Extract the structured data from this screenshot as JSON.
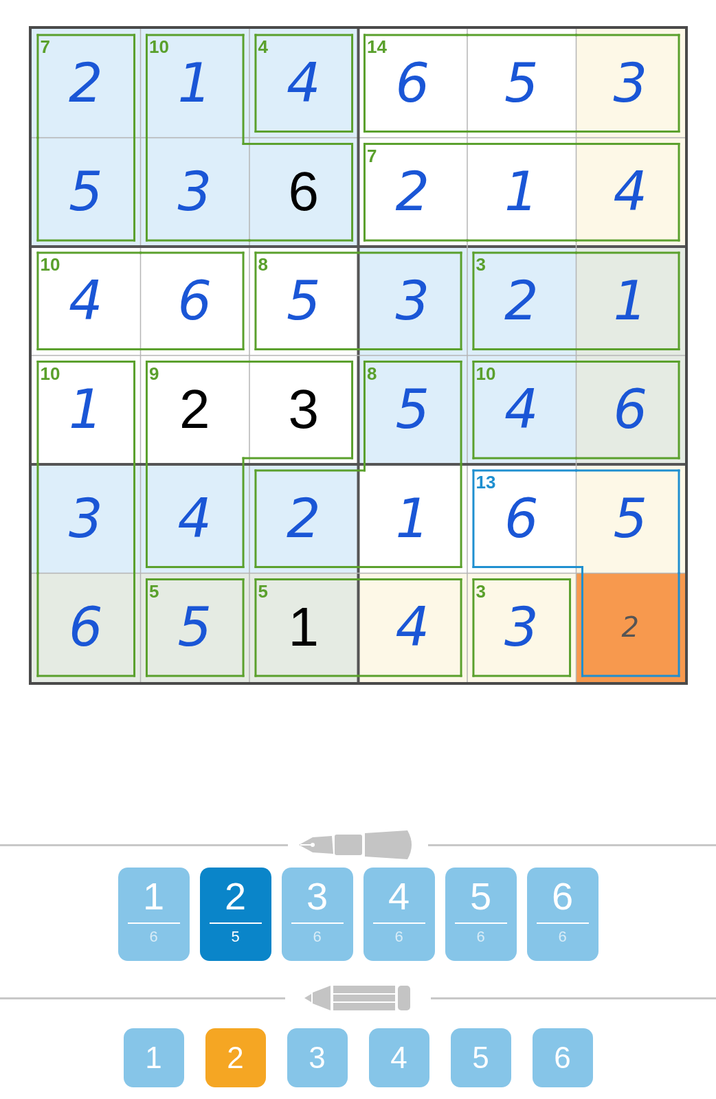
{
  "grid": {
    "rows": [
      [
        {
          "value": "2",
          "kind": "entered",
          "color": "#ddeefa",
          "selected": false,
          "cage": {
            "sum": "7",
            "color": "#5aa02c",
            "top": true,
            "right": true,
            "bottom": false,
            "left": true
          }
        },
        {
          "value": "1",
          "kind": "entered",
          "color": "#ddeefa",
          "selected": false,
          "cage": {
            "sum": "10",
            "color": "#5aa02c",
            "top": true,
            "right": true,
            "bottom": false,
            "left": true
          }
        },
        {
          "value": "4",
          "kind": "entered",
          "color": "#ddeefa",
          "selected": false,
          "cage": {
            "sum": "4",
            "color": "#5aa02c",
            "top": true,
            "right": true,
            "bottom": true,
            "left": true
          }
        },
        {
          "value": "6",
          "kind": "entered",
          "color": "#ffffff",
          "selected": false,
          "cage": {
            "sum": "14",
            "color": "#5aa02c",
            "top": true,
            "right": false,
            "bottom": true,
            "left": true
          }
        },
        {
          "value": "5",
          "kind": "entered",
          "color": "#ffffff",
          "selected": false,
          "cage": {
            "color": "#5aa02c",
            "top": true,
            "right": false,
            "bottom": true,
            "left": false
          }
        },
        {
          "value": "3",
          "kind": "entered",
          "color": "#fdf8e7",
          "selected": false,
          "cage": {
            "color": "#5aa02c",
            "top": true,
            "right": true,
            "bottom": true,
            "left": false
          }
        }
      ],
      [
        {
          "value": "5",
          "kind": "entered",
          "color": "#ddeefa",
          "selected": false,
          "cage": {
            "color": "#5aa02c",
            "top": false,
            "right": true,
            "bottom": true,
            "left": true
          }
        },
        {
          "value": "3",
          "kind": "entered",
          "color": "#ddeefa",
          "selected": false,
          "cage": {
            "color": "#5aa02c",
            "top": false,
            "right": false,
            "bottom": true,
            "left": true
          }
        },
        {
          "value": "6",
          "kind": "given",
          "color": "#ddeefa",
          "selected": false,
          "cage": {
            "color": "#5aa02c",
            "top": true,
            "right": true,
            "bottom": true,
            "left": false
          }
        },
        {
          "value": "2",
          "kind": "entered",
          "color": "#ffffff",
          "selected": false,
          "cage": {
            "sum": "7",
            "color": "#5aa02c",
            "top": true,
            "right": false,
            "bottom": true,
            "left": true
          }
        },
        {
          "value": "1",
          "kind": "entered",
          "color": "#ffffff",
          "selected": false,
          "cage": {
            "color": "#5aa02c",
            "top": true,
            "right": false,
            "bottom": true,
            "left": false
          }
        },
        {
          "value": "4",
          "kind": "entered",
          "color": "#fdf8e7",
          "selected": false,
          "cage": {
            "color": "#5aa02c",
            "top": true,
            "right": true,
            "bottom": true,
            "left": false
          }
        }
      ],
      [
        {
          "value": "4",
          "kind": "entered",
          "color": "#ffffff",
          "selected": false,
          "cage": {
            "sum": "10",
            "color": "#5aa02c",
            "top": true,
            "right": false,
            "bottom": true,
            "left": true
          }
        },
        {
          "value": "6",
          "kind": "entered",
          "color": "#ffffff",
          "selected": false,
          "cage": {
            "color": "#5aa02c",
            "top": true,
            "right": true,
            "bottom": true,
            "left": false
          }
        },
        {
          "value": "5",
          "kind": "entered",
          "color": "#ffffff",
          "selected": false,
          "cage": {
            "sum": "8",
            "color": "#5aa02c",
            "top": true,
            "right": false,
            "bottom": true,
            "left": true
          }
        },
        {
          "value": "3",
          "kind": "entered",
          "color": "#ddeefa",
          "selected": false,
          "cage": {
            "color": "#5aa02c",
            "top": true,
            "right": true,
            "bottom": true,
            "left": false
          }
        },
        {
          "value": "2",
          "kind": "entered",
          "color": "#ddeefa",
          "selected": false,
          "cage": {
            "sum": "3",
            "color": "#5aa02c",
            "top": true,
            "right": false,
            "bottom": true,
            "left": true
          }
        },
        {
          "value": "1",
          "kind": "entered",
          "color": "#e5ebe3",
          "selected": false,
          "cage": {
            "color": "#5aa02c",
            "top": true,
            "right": true,
            "bottom": true,
            "left": false
          }
        }
      ],
      [
        {
          "value": "1",
          "kind": "entered",
          "color": "#ffffff",
          "selected": false,
          "cage": {
            "sum": "10",
            "color": "#5aa02c",
            "top": true,
            "right": true,
            "bottom": false,
            "left": true
          }
        },
        {
          "value": "2",
          "kind": "given",
          "color": "#ffffff",
          "selected": false,
          "cage": {
            "sum": "9",
            "color": "#5aa02c",
            "top": true,
            "right": false,
            "bottom": false,
            "left": true
          }
        },
        {
          "value": "3",
          "kind": "given",
          "color": "#ffffff",
          "selected": false,
          "cage": {
            "color": "#5aa02c",
            "top": true,
            "right": true,
            "bottom": true,
            "left": false
          }
        },
        {
          "value": "5",
          "kind": "entered",
          "color": "#ddeefa",
          "selected": false,
          "cage": {
            "sum": "8",
            "color": "#5aa02c",
            "top": true,
            "right": true,
            "bottom": false,
            "left": true
          }
        },
        {
          "value": "4",
          "kind": "entered",
          "color": "#ddeefa",
          "selected": false,
          "cage": {
            "sum": "10",
            "color": "#5aa02c",
            "top": true,
            "right": false,
            "bottom": true,
            "left": true
          }
        },
        {
          "value": "6",
          "kind": "entered",
          "color": "#e5ebe3",
          "selected": false,
          "cage": {
            "color": "#5aa02c",
            "top": true,
            "right": true,
            "bottom": true,
            "left": false
          }
        }
      ],
      [
        {
          "value": "3",
          "kind": "entered",
          "color": "#ddeefa",
          "selected": false,
          "cage": {
            "color": "#5aa02c",
            "top": false,
            "right": true,
            "bottom": false,
            "left": true
          }
        },
        {
          "value": "4",
          "kind": "entered",
          "color": "#ddeefa",
          "selected": false,
          "cage": {
            "color": "#5aa02c",
            "top": false,
            "right": true,
            "bottom": true,
            "left": true
          }
        },
        {
          "value": "2",
          "kind": "entered",
          "color": "#ddeefa",
          "selected": false,
          "cage": {
            "color": "#5aa02c",
            "top": true,
            "right": false,
            "bottom": true,
            "left": true
          }
        },
        {
          "value": "1",
          "kind": "entered",
          "color": "#ffffff",
          "selected": false,
          "cage": {
            "color": "#5aa02c",
            "top": false,
            "right": true,
            "bottom": true,
            "left": false
          }
        },
        {
          "value": "6",
          "kind": "entered",
          "color": "#ffffff",
          "selected": false,
          "cage": {
            "sum": "13",
            "color": "#1e8fd0",
            "top": true,
            "right": false,
            "bottom": true,
            "left": true
          }
        },
        {
          "value": "5",
          "kind": "entered",
          "color": "#fdf8e7",
          "selected": false,
          "cage": {
            "color": "#1e8fd0",
            "top": true,
            "right": true,
            "bottom": false,
            "left": false
          }
        }
      ],
      [
        {
          "value": "6",
          "kind": "entered",
          "color": "#e5ebe3",
          "selected": false,
          "cage": {
            "color": "#5aa02c",
            "top": false,
            "right": true,
            "bottom": true,
            "left": true
          }
        },
        {
          "value": "5",
          "kind": "entered",
          "color": "#e5ebe3",
          "selected": false,
          "cage": {
            "sum": "5",
            "color": "#5aa02c",
            "top": true,
            "right": true,
            "bottom": true,
            "left": true
          }
        },
        {
          "value": "1",
          "kind": "given",
          "color": "#e5ebe3",
          "selected": false,
          "cage": {
            "sum": "5",
            "color": "#5aa02c",
            "top": true,
            "right": false,
            "bottom": true,
            "left": true
          }
        },
        {
          "value": "4",
          "kind": "entered",
          "color": "#fdf8e7",
          "selected": false,
          "cage": {
            "color": "#5aa02c",
            "top": true,
            "right": true,
            "bottom": true,
            "left": false
          }
        },
        {
          "value": "3",
          "kind": "entered",
          "color": "#fdf8e7",
          "selected": false,
          "cage": {
            "sum": "3",
            "color": "#5aa02c",
            "top": true,
            "right": true,
            "bottom": true,
            "left": true
          }
        },
        {
          "value": "2",
          "kind": "note",
          "selected": true,
          "cage": {
            "color": "#1e8fd0",
            "top": false,
            "right": true,
            "bottom": true,
            "left": true
          }
        }
      ]
    ]
  },
  "pen_pad": {
    "buttons": [
      {
        "digit": "1",
        "count": "6",
        "selected": false
      },
      {
        "digit": "2",
        "count": "5",
        "selected": true
      },
      {
        "digit": "3",
        "count": "6",
        "selected": false
      },
      {
        "digit": "4",
        "count": "6",
        "selected": false
      },
      {
        "digit": "5",
        "count": "6",
        "selected": false
      },
      {
        "digit": "6",
        "count": "6",
        "selected": false
      }
    ]
  },
  "pencil_pad": {
    "buttons": [
      {
        "digit": "1",
        "selected": false
      },
      {
        "digit": "2",
        "selected": true
      },
      {
        "digit": "3",
        "selected": false
      },
      {
        "digit": "4",
        "selected": false
      },
      {
        "digit": "5",
        "selected": false
      },
      {
        "digit": "6",
        "selected": false
      }
    ]
  }
}
